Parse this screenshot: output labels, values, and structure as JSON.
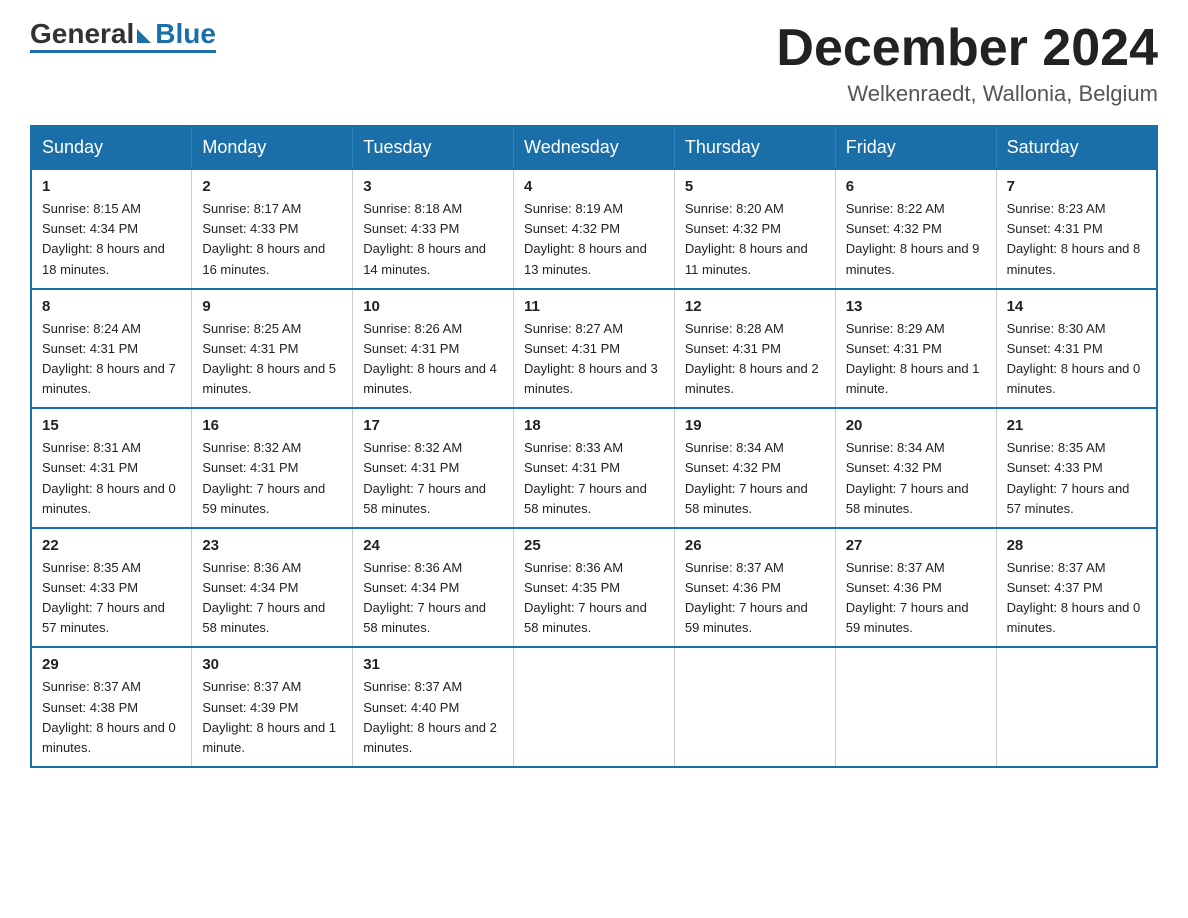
{
  "header": {
    "logo_general": "General",
    "logo_blue": "Blue",
    "month_title": "December 2024",
    "location": "Welkenraedt, Wallonia, Belgium"
  },
  "days_of_week": [
    "Sunday",
    "Monday",
    "Tuesday",
    "Wednesday",
    "Thursday",
    "Friday",
    "Saturday"
  ],
  "weeks": [
    [
      {
        "day": "1",
        "sunrise": "8:15 AM",
        "sunset": "4:34 PM",
        "daylight": "8 hours and 18 minutes."
      },
      {
        "day": "2",
        "sunrise": "8:17 AM",
        "sunset": "4:33 PM",
        "daylight": "8 hours and 16 minutes."
      },
      {
        "day": "3",
        "sunrise": "8:18 AM",
        "sunset": "4:33 PM",
        "daylight": "8 hours and 14 minutes."
      },
      {
        "day": "4",
        "sunrise": "8:19 AM",
        "sunset": "4:32 PM",
        "daylight": "8 hours and 13 minutes."
      },
      {
        "day": "5",
        "sunrise": "8:20 AM",
        "sunset": "4:32 PM",
        "daylight": "8 hours and 11 minutes."
      },
      {
        "day": "6",
        "sunrise": "8:22 AM",
        "sunset": "4:32 PM",
        "daylight": "8 hours and 9 minutes."
      },
      {
        "day": "7",
        "sunrise": "8:23 AM",
        "sunset": "4:31 PM",
        "daylight": "8 hours and 8 minutes."
      }
    ],
    [
      {
        "day": "8",
        "sunrise": "8:24 AM",
        "sunset": "4:31 PM",
        "daylight": "8 hours and 7 minutes."
      },
      {
        "day": "9",
        "sunrise": "8:25 AM",
        "sunset": "4:31 PM",
        "daylight": "8 hours and 5 minutes."
      },
      {
        "day": "10",
        "sunrise": "8:26 AM",
        "sunset": "4:31 PM",
        "daylight": "8 hours and 4 minutes."
      },
      {
        "day": "11",
        "sunrise": "8:27 AM",
        "sunset": "4:31 PM",
        "daylight": "8 hours and 3 minutes."
      },
      {
        "day": "12",
        "sunrise": "8:28 AM",
        "sunset": "4:31 PM",
        "daylight": "8 hours and 2 minutes."
      },
      {
        "day": "13",
        "sunrise": "8:29 AM",
        "sunset": "4:31 PM",
        "daylight": "8 hours and 1 minute."
      },
      {
        "day": "14",
        "sunrise": "8:30 AM",
        "sunset": "4:31 PM",
        "daylight": "8 hours and 0 minutes."
      }
    ],
    [
      {
        "day": "15",
        "sunrise": "8:31 AM",
        "sunset": "4:31 PM",
        "daylight": "8 hours and 0 minutes."
      },
      {
        "day": "16",
        "sunrise": "8:32 AM",
        "sunset": "4:31 PM",
        "daylight": "7 hours and 59 minutes."
      },
      {
        "day": "17",
        "sunrise": "8:32 AM",
        "sunset": "4:31 PM",
        "daylight": "7 hours and 58 minutes."
      },
      {
        "day": "18",
        "sunrise": "8:33 AM",
        "sunset": "4:31 PM",
        "daylight": "7 hours and 58 minutes."
      },
      {
        "day": "19",
        "sunrise": "8:34 AM",
        "sunset": "4:32 PM",
        "daylight": "7 hours and 58 minutes."
      },
      {
        "day": "20",
        "sunrise": "8:34 AM",
        "sunset": "4:32 PM",
        "daylight": "7 hours and 58 minutes."
      },
      {
        "day": "21",
        "sunrise": "8:35 AM",
        "sunset": "4:33 PM",
        "daylight": "7 hours and 57 minutes."
      }
    ],
    [
      {
        "day": "22",
        "sunrise": "8:35 AM",
        "sunset": "4:33 PM",
        "daylight": "7 hours and 57 minutes."
      },
      {
        "day": "23",
        "sunrise": "8:36 AM",
        "sunset": "4:34 PM",
        "daylight": "7 hours and 58 minutes."
      },
      {
        "day": "24",
        "sunrise": "8:36 AM",
        "sunset": "4:34 PM",
        "daylight": "7 hours and 58 minutes."
      },
      {
        "day": "25",
        "sunrise": "8:36 AM",
        "sunset": "4:35 PM",
        "daylight": "7 hours and 58 minutes."
      },
      {
        "day": "26",
        "sunrise": "8:37 AM",
        "sunset": "4:36 PM",
        "daylight": "7 hours and 59 minutes."
      },
      {
        "day": "27",
        "sunrise": "8:37 AM",
        "sunset": "4:36 PM",
        "daylight": "7 hours and 59 minutes."
      },
      {
        "day": "28",
        "sunrise": "8:37 AM",
        "sunset": "4:37 PM",
        "daylight": "8 hours and 0 minutes."
      }
    ],
    [
      {
        "day": "29",
        "sunrise": "8:37 AM",
        "sunset": "4:38 PM",
        "daylight": "8 hours and 0 minutes."
      },
      {
        "day": "30",
        "sunrise": "8:37 AM",
        "sunset": "4:39 PM",
        "daylight": "8 hours and 1 minute."
      },
      {
        "day": "31",
        "sunrise": "8:37 AM",
        "sunset": "4:40 PM",
        "daylight": "8 hours and 2 minutes."
      },
      null,
      null,
      null,
      null
    ]
  ]
}
